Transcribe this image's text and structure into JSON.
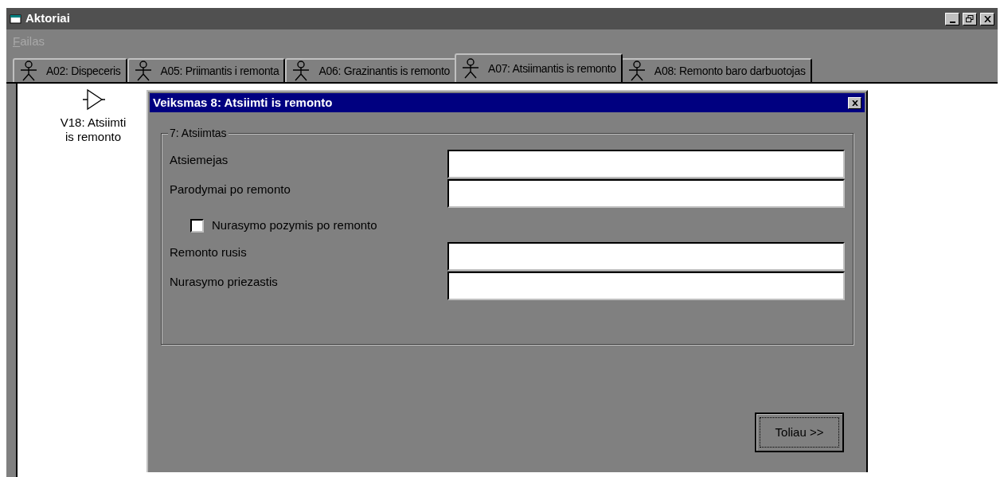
{
  "window": {
    "title": "Aktoriai"
  },
  "menu": [
    {
      "label": "Failas",
      "disabled": true
    }
  ],
  "tabs": [
    {
      "label": "A02: Dispeceris",
      "selected": false
    },
    {
      "label": "A05: Priimantis i remonta",
      "selected": false
    },
    {
      "label": "A06: Grazinantis is remonto",
      "selected": false
    },
    {
      "label": "A07: Atsiimantis is remonto",
      "selected": true
    },
    {
      "label": "A08: Remonto baro darbuotojas",
      "selected": false
    }
  ],
  "canvas": {
    "items": [
      {
        "label": "V18: Atsiimti is remonto"
      }
    ]
  },
  "dialog": {
    "title": "Veiksmas 8: Atsiimti is remonto",
    "group": {
      "title": "7: Atsiimtas",
      "fields": [
        {
          "kind": "text",
          "label": "Atsiemejas"
        },
        {
          "kind": "text",
          "label": "Parodymai po remonto"
        },
        {
          "kind": "checkbox",
          "label": "Nurasymo pozymis po remonto",
          "checked": false
        },
        {
          "kind": "text",
          "label": "Remonto rusis"
        },
        {
          "kind": "text",
          "label": "Nurasymo priezastis"
        }
      ]
    },
    "button": "Toliau >>"
  }
}
